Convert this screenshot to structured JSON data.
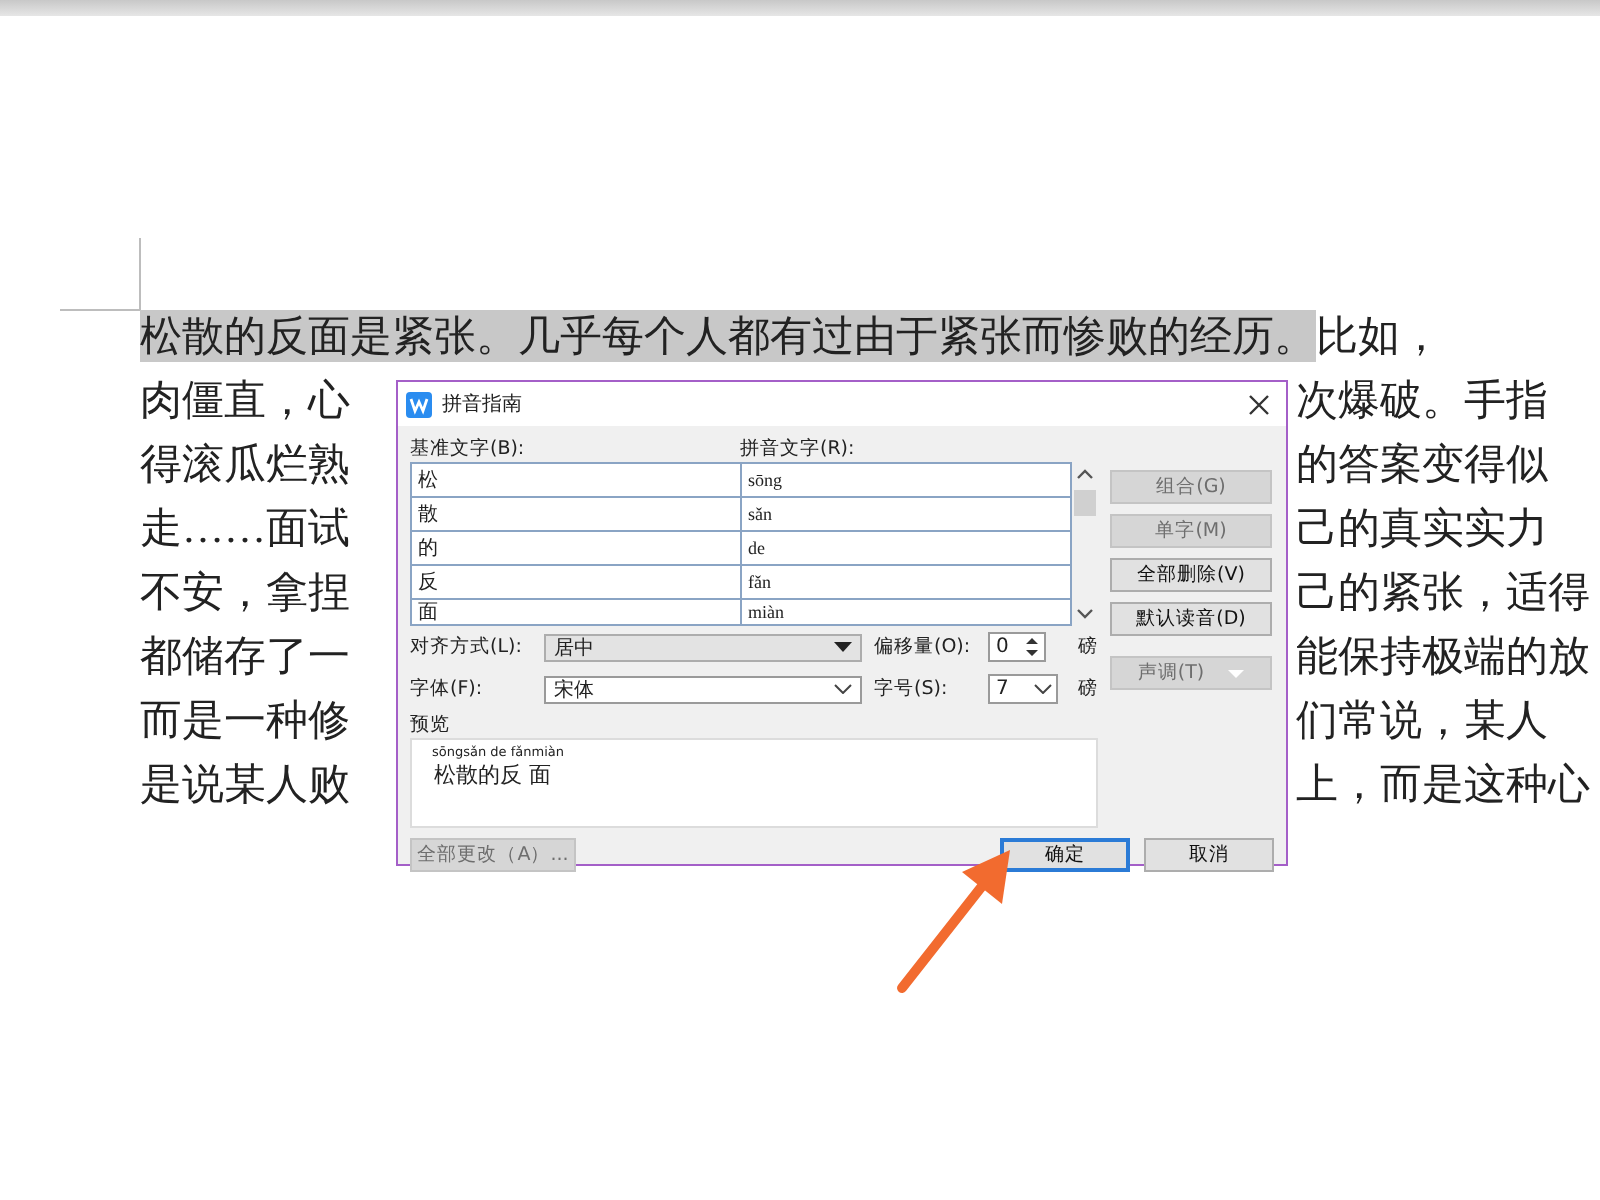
{
  "document": {
    "lines": [
      {
        "kind": "full",
        "parts": [
          {
            "text": "松散的反面是紧张。几乎每个人都有过由于紧张而惨败的经历。",
            "highlighted": true
          },
          {
            "text": "比如，",
            "highlighted": false
          }
        ]
      },
      {
        "kind": "split",
        "left": "肉僵直，心",
        "right": "次爆破。手指"
      },
      {
        "kind": "split",
        "left": "得滚瓜烂熟",
        "right": "的答案变得似"
      },
      {
        "kind": "split",
        "left": "走……面试",
        "right": "己的真实实力"
      },
      {
        "kind": "split",
        "left": "不安，拿捏",
        "right": "己的紧张，适得"
      },
      {
        "kind": "split",
        "left": "都储存了一",
        "right": "能保持极端的放"
      },
      {
        "kind": "split",
        "left": "而是一种修",
        "right": "们常说，某人"
      },
      {
        "kind": "split",
        "left": "是说某人败",
        "right": "上，而是这种心"
      }
    ]
  },
  "dialog": {
    "title": "拼音指南",
    "columns": [
      "基准文字(B):",
      "拼音文字(R):"
    ],
    "rows": [
      {
        "base": "松",
        "pinyin": "sōng"
      },
      {
        "base": "散",
        "pinyin": "sǎn"
      },
      {
        "base": "的",
        "pinyin": "de"
      },
      {
        "base": "反",
        "pinyin": "fǎn"
      },
      {
        "base": "面",
        "pinyin": "miàn"
      }
    ],
    "side_buttons": [
      {
        "kind": "button",
        "label": "组合(G)",
        "disabled": true
      },
      {
        "kind": "button",
        "label": "单字(M)",
        "disabled": true
      },
      {
        "kind": "button",
        "label": "全部删除(V)",
        "disabled": false
      },
      {
        "kind": "button",
        "label": "默认读音(D)",
        "disabled": false
      },
      {
        "kind": "dropdown",
        "label": "声调(T)",
        "disabled": true
      }
    ],
    "alignment": {
      "label": "对齐方式(L):",
      "value": "居中"
    },
    "offset": {
      "label": "偏移量(O):",
      "value": "0",
      "unit": "磅"
    },
    "font": {
      "label": "字体(F):",
      "value": "宋体"
    },
    "size": {
      "label": "字号(S):",
      "value": "7",
      "unit": "磅"
    },
    "preview": {
      "label": "预览",
      "ruby": "sōngsǎn de fǎnmiàn",
      "text": "松散的反 面"
    },
    "bottom_buttons": [
      {
        "label": "全部更改（A）...",
        "disabled": true,
        "default": false
      },
      {
        "label": "确定",
        "disabled": false,
        "default": true
      },
      {
        "label": "取消",
        "disabled": false,
        "default": false
      }
    ]
  }
}
